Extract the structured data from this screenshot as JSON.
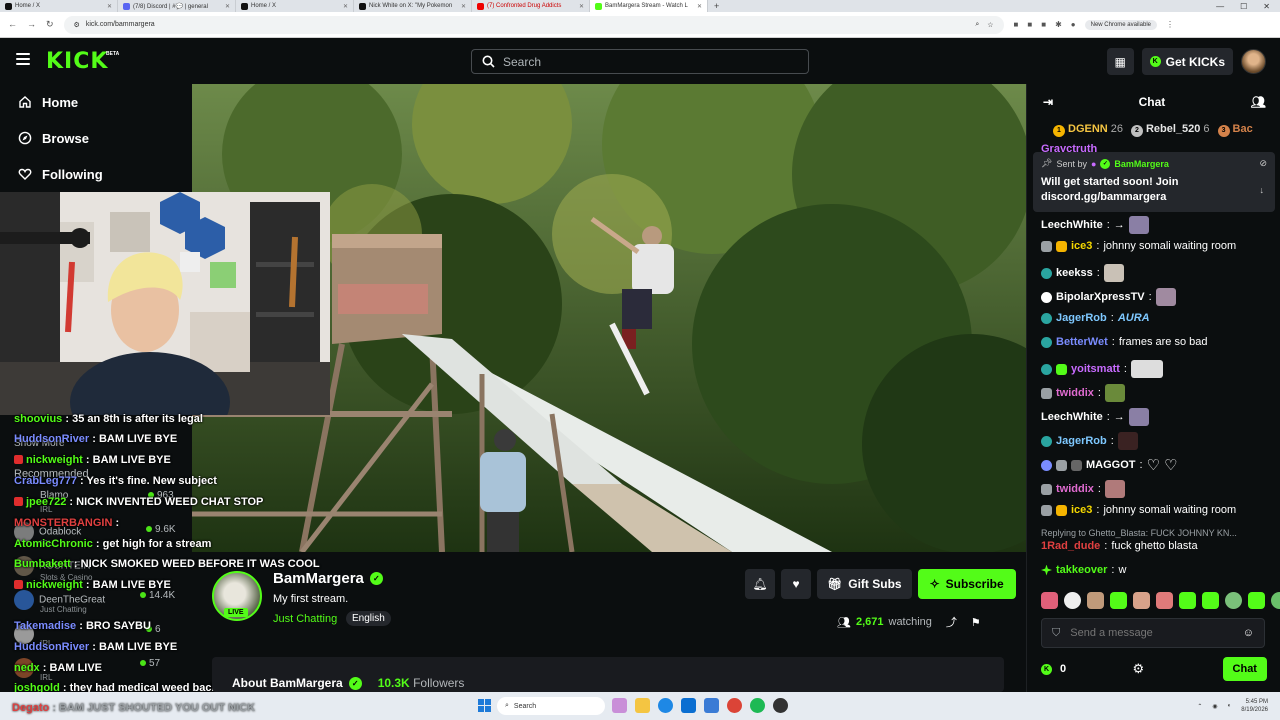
{
  "browser": {
    "tabs": [
      {
        "label": "Home / X",
        "active": false
      },
      {
        "label": "(7/8) Discord | #💬 | general",
        "active": false
      },
      {
        "label": "Home / X",
        "active": false
      },
      {
        "label": "Nick White on X: \"My Pokemon",
        "active": false
      },
      {
        "label": "(7) Confronted Drug Addicts",
        "active": false
      },
      {
        "label": "BamMargera Stream - Watch L",
        "active": true
      }
    ],
    "new_tab": "+",
    "url": "kick.com/bammargera",
    "chrome_notice": "New Chrome available"
  },
  "header": {
    "logo": "KICK",
    "logo_badge": "BETA",
    "search_placeholder": "Search",
    "get_kicks_label": "Get KICKs"
  },
  "nav": {
    "items": [
      {
        "label": "Home",
        "icon": "home-icon"
      },
      {
        "label": "Browse",
        "icon": "compass-icon"
      },
      {
        "label": "Following",
        "icon": "heart-icon"
      }
    ]
  },
  "overlay_chat": {
    "lines": [
      {
        "user": "shoovius",
        "color": "#53fc18",
        "text": " : 35 an 8th is after its legal"
      },
      {
        "user": "HuddsonRiver",
        "color": "#7a8cff",
        "text": " : BAM LIVE BYE"
      },
      {
        "user": "nickweight",
        "color": "#53fc18",
        "text": " : BAM LIVE BYE"
      },
      {
        "user": "CrabLeg777",
        "color": "#7a8cff",
        "text": " : Yes it's fine. New subject"
      },
      {
        "user": "jpee722",
        "color": "#53fc18",
        "text": " : NICK INVENTED WEED CHAT STOP"
      },
      {
        "user": "MONSTERBANGIN",
        "color": "#e04040",
        "text": " :"
      },
      {
        "user": "AtomicChronic",
        "color": "#53fc18",
        "text": " : get high for a stream"
      },
      {
        "user": "Bumbakett",
        "color": "#53fc18",
        "text": " : NICK SMOKED WEED BEFORE IT WAS COOL"
      },
      {
        "user": "nickweight",
        "color": "#53fc18",
        "text": " : BAM LIVE BYE"
      },
      {
        "user": "Takemadise",
        "color": "#7a8cff",
        "text": " : BRO SAYBU"
      },
      {
        "user": "HuddsonRiver",
        "color": "#7a8cff",
        "text": " : BAM LIVE BYE"
      },
      {
        "user": "nedx",
        "color": "#53fc18",
        "text": " : BAM LIVE"
      },
      {
        "user": "joshgold",
        "color": "#53fc18",
        "text": " : they had medical weed back then"
      }
    ],
    "bottom_line": {
      "user": "Degato",
      "text": " : BAM JUST SHOUTED YOU OUT NICK"
    },
    "ghost": {
      "show_more": "Show More",
      "recommended": "Recommended",
      "items": [
        {
          "name": "Blamo",
          "count": "963",
          "cat": "IRL"
        },
        {
          "name": "Odablock",
          "count": "9.6K",
          "cat": "IRL"
        },
        {
          "name": "ROSHTEIN",
          "count": "",
          "cat": "Slots & Casino"
        },
        {
          "name": "DeenTheGreat",
          "count": "14.4K",
          "cat": "Just Chatting"
        },
        {
          "name": "",
          "count": "6",
          "cat": "IRL"
        },
        {
          "name": "",
          "count": "57",
          "cat": "IRL"
        }
      ]
    }
  },
  "stream": {
    "streamer": "BamMargera",
    "title": "My first stream.",
    "category": "Just Chatting",
    "language": "English",
    "live_badge": "LIVE",
    "gift_subs_label": "Gift Subs",
    "subscribe_label": "Subscribe",
    "viewers": "2,671",
    "viewers_suffix": "watching",
    "about_title": "About BamMargera",
    "followers_count": "10.3K",
    "followers_label": "Followers"
  },
  "chat": {
    "title": "Chat",
    "leaderboard": [
      {
        "rank": "1",
        "name": "DGENN",
        "score": "26",
        "color": "#f5b400"
      },
      {
        "rank": "2",
        "name": "Rebel_520",
        "score": "6",
        "color": "#c0c0c0"
      },
      {
        "rank": "3",
        "name": "Bac",
        "score": "",
        "color": "#d4824a"
      }
    ],
    "partial_user": "Grayctruth",
    "pinned": {
      "sent_by_label": "Sent by",
      "sender": "BamMargera",
      "message": "Will get started soon! Join discord.gg/bammargera"
    },
    "messages": [
      {
        "user": "LeechWhite",
        "color": "#ffffff",
        "text": "→"
      },
      {
        "user": "ice3",
        "color": "#f5d800",
        "text": "johnny somali waiting room"
      },
      {
        "user": "keekss",
        "color": "#ffffff",
        "text": ""
      },
      {
        "user": "BipolarXpressTV",
        "color": "#ffffff",
        "text": ""
      },
      {
        "user": "JagerRob",
        "color": "#7ec8ff",
        "text": "AURA"
      },
      {
        "user": "BetterWet",
        "color": "#7a8cff",
        "text": "frames are so bad"
      },
      {
        "user": "yoitsmatt",
        "color": "#c86bff",
        "text": ""
      },
      {
        "user": "twiddix",
        "color": "#e06bd0",
        "text": ""
      },
      {
        "user": "LeechWhite",
        "color": "#ffffff",
        "text": "→"
      },
      {
        "user": "JagerRob",
        "color": "#7ec8ff",
        "text": ""
      },
      {
        "user": "MAGGOT",
        "color": "#ffffff",
        "text": "♡ ♡"
      },
      {
        "user": "twiddix",
        "color": "#e06bd0",
        "text": ""
      },
      {
        "user": "ice3",
        "color": "#f5d800",
        "text": "johnny somali waiting room"
      },
      {
        "user": "1Rad_dude",
        "color": "#e04040",
        "text": "fuck ghetto blasta"
      },
      {
        "user": "takkeover",
        "color": "#53fc18",
        "text": "w"
      }
    ],
    "reply_to": "Replying to Ghetto_Blasta: FUCK JOHNNY KN...",
    "input_placeholder": "Send a message",
    "kicks_count": "0",
    "send_label": "Chat"
  },
  "taskbar": {
    "search_placeholder": "Search",
    "time": "5:45 PM",
    "date": "8/19/2026"
  }
}
